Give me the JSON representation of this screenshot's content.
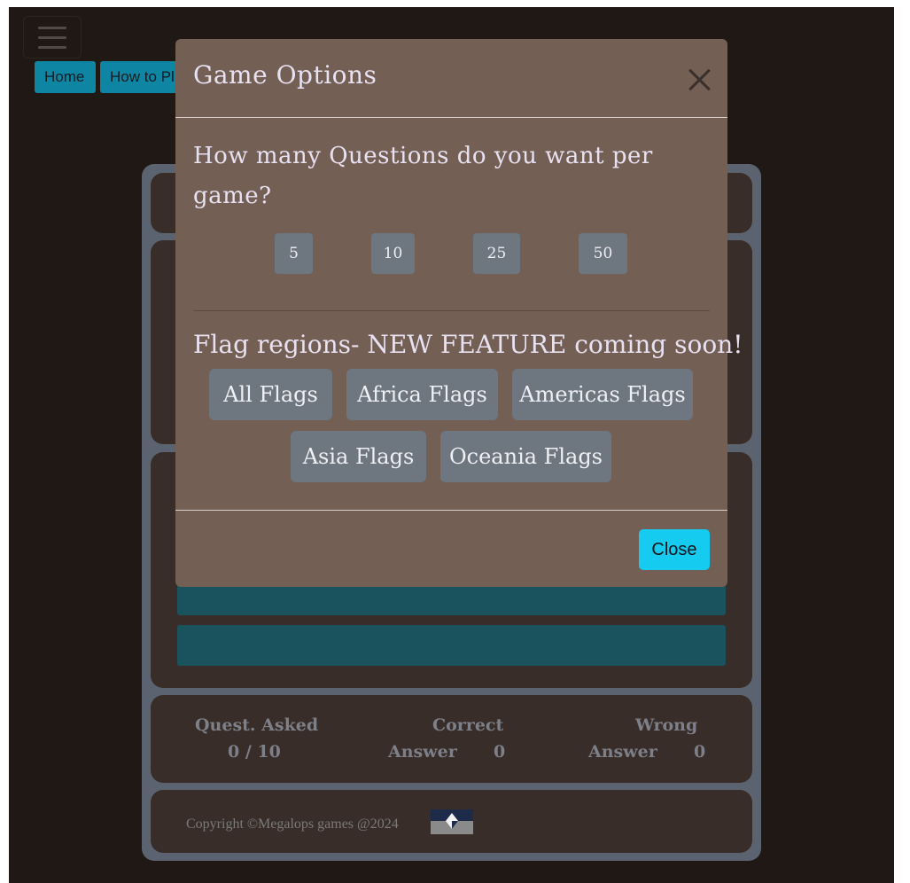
{
  "nav": {
    "menu_icon": "hamburger-menu-icon",
    "home": "Home",
    "how_to_play": "How to Pl"
  },
  "stats": {
    "asked_label": "Quest. Asked",
    "asked_value": "0 / 10",
    "correct_label_1": "Correct",
    "correct_label_2": "Answer",
    "correct_value": "0",
    "wrong_label_1": "Wrong",
    "wrong_label_2": "Answer",
    "wrong_value": "0"
  },
  "footer": {
    "copyright": "Copyright ©Megalops games @2024"
  },
  "modal": {
    "title": "Game Options",
    "close_icon": "close-icon",
    "questions_heading": "How many Questions do you want per game?",
    "question_options": [
      "5",
      "10",
      "25",
      "50"
    ],
    "regions_heading": "Flag regions- NEW FEATURE coming soon!",
    "regions": [
      "All Flags",
      "Africa Flags",
      "Americas Flags",
      "Asia Flags",
      "Oceania Flags"
    ],
    "close_button": "Close"
  },
  "colors": {
    "page_bg": "#201814",
    "modal_bg": "#735f54",
    "nav_button": "#0e86a3",
    "option_button": "#6e7680",
    "close_button": "#16cbf0",
    "answer_button": "#1a535e"
  }
}
